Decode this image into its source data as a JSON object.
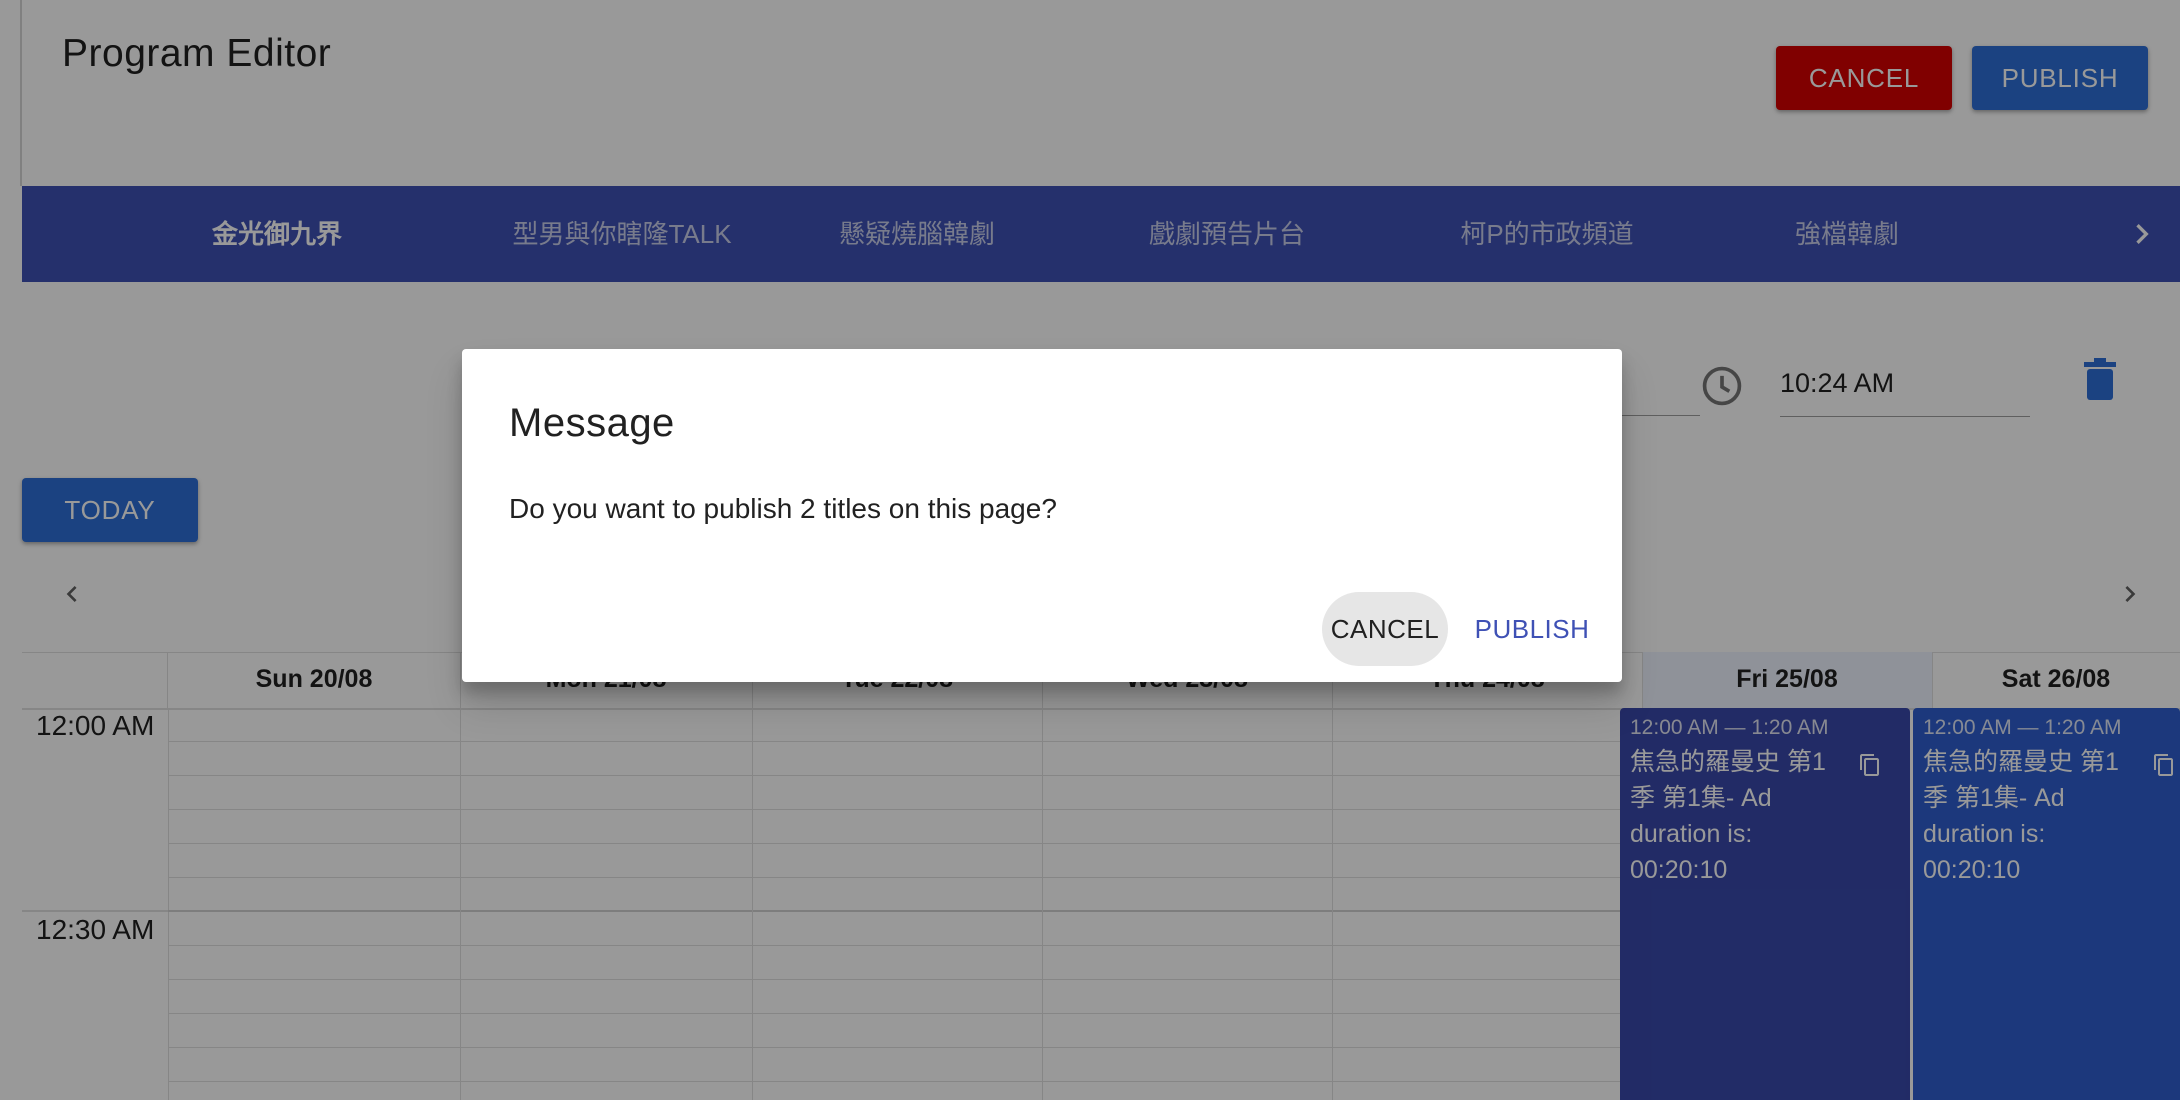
{
  "app": {
    "title": "Program Editor"
  },
  "header": {
    "cancel_label": "CANCEL",
    "publish_label": "PUBLISH"
  },
  "tabs": [
    {
      "label": "金光御九界",
      "active": true
    },
    {
      "label": "型男與你瞎隆TALK",
      "active": false
    },
    {
      "label": "懸疑燒腦韓劇",
      "active": false
    },
    {
      "label": "戲劇預告片台",
      "active": false
    },
    {
      "label": "柯P的市政頻道",
      "active": false
    },
    {
      "label": "強檔韓劇",
      "active": false
    }
  ],
  "toolbar": {
    "time_value": "10:24 AM",
    "today_label": "TODAY"
  },
  "calendar": {
    "days": [
      "Sun 20/08",
      "Mon 21/08",
      "Tue 22/08",
      "Wed 23/08",
      "Thu 24/08",
      "Fri 25/08",
      "Sat 26/08"
    ],
    "time_slots": [
      "12:00 AM",
      "12:30 AM"
    ],
    "events": [
      {
        "day": "Fri 25/08",
        "time": "12:00 AM — 1:20 AM",
        "title": "焦急的羅曼史 第1季 第1集- Ad duration is: 00:20:10"
      },
      {
        "day": "Sat 26/08",
        "time": "12:00 AM — 1:20 AM",
        "title": "焦急的羅曼史 第1季 第1集- Ad duration is: 00:20:10"
      }
    ]
  },
  "dialog": {
    "title": "Message",
    "body": "Do you want to publish 2 titles on this page?",
    "cancel_label": "CANCEL",
    "publish_label": "PUBLISH"
  },
  "colors": {
    "primary": "#3f51b5",
    "brand_blue": "#2e6fd8",
    "danger": "#d50000",
    "event_fri": "#3949ab",
    "event_sat": "#2f5ecf",
    "highlight_day": "#eef3ff"
  },
  "icons": [
    "chevron-right-icon",
    "clock-icon",
    "trash-icon",
    "chevron-left-icon",
    "copy-icon"
  ]
}
